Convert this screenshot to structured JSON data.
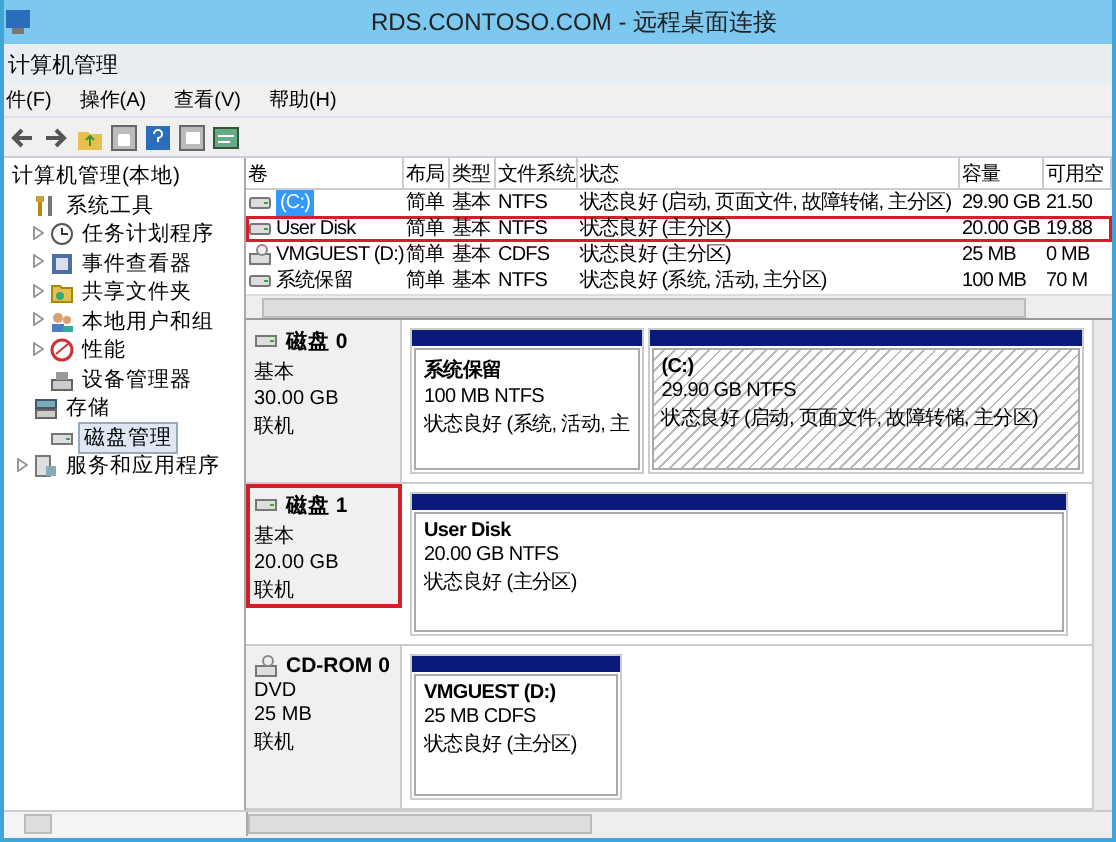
{
  "rds_title": "RDS.CONTOSO.COM - 远程桌面连接",
  "window": {
    "title": "计算机管理"
  },
  "menu": [
    "件(F)",
    "操作(A)",
    "查看(V)",
    "帮助(H)"
  ],
  "tree": [
    {
      "label": "计算机管理(本地)",
      "selected": false,
      "children": [
        {
          "label": "系统工具",
          "selected": false,
          "children": [
            {
              "label": "任务计划程序",
              "selected": false,
              "expanded": false
            },
            {
              "label": "事件查看器",
              "selected": false,
              "expanded": false
            },
            {
              "label": "共享文件夹",
              "selected": false,
              "expanded": false
            },
            {
              "label": "本地用户和组",
              "selected": false,
              "expanded": false
            },
            {
              "label": "性能",
              "selected": false,
              "expanded": false
            },
            {
              "label": "设备管理器",
              "selected": false
            }
          ]
        },
        {
          "label": "存储",
          "selected": false,
          "children": [
            {
              "label": "磁盘管理",
              "selected": true
            }
          ]
        },
        {
          "label": "服务和应用程序",
          "selected": false,
          "expanded": false
        }
      ]
    }
  ],
  "volumes": {
    "columns": [
      "卷",
      "布局",
      "类型",
      "文件系统",
      "状态",
      "容量",
      "可用空"
    ],
    "rows": [
      {
        "kind": "hdd",
        "cells": [
          "(C:)",
          "简单",
          "基本",
          "NTFS",
          "状态良好 (启动, 页面文件, 故障转储, 主分区)",
          "29.90 GB",
          "21.50"
        ],
        "selected": true,
        "highlighted": false
      },
      {
        "kind": "hdd",
        "cells": [
          "User Disk",
          "简单",
          "基本",
          "NTFS",
          "状态良好 (主分区)",
          "20.00 GB",
          "19.88"
        ],
        "selected": false,
        "highlighted": true
      },
      {
        "kind": "cdrom",
        "cells": [
          "VMGUEST (D:)",
          "简单",
          "基本",
          "CDFS",
          "状态良好 (主分区)",
          "25 MB",
          "0 MB"
        ],
        "selected": false,
        "highlighted": false
      },
      {
        "kind": "hdd",
        "cells": [
          "系统保留",
          "简单",
          "基本",
          "NTFS",
          "状态良好 (系统, 活动, 主分区)",
          "100 MB",
          "70 M"
        ],
        "selected": false,
        "highlighted": false
      }
    ]
  },
  "disks": [
    {
      "kind": "disk",
      "name": "磁盘 0",
      "type": "基本",
      "size": "30.00 GB",
      "status": "联机",
      "highlighted": false,
      "partitions": [
        {
          "name": "系统保留",
          "detail": "100 MB NTFS",
          "status": "状态良好 (系统, 活动, 主",
          "selected": false
        },
        {
          "name": "(C:)",
          "detail": "29.90 GB NTFS",
          "status": "状态良好 (启动, 页面文件, 故障转储, 主分区)",
          "selected": true
        }
      ]
    },
    {
      "kind": "disk",
      "name": "磁盘 1",
      "type": "基本",
      "size": "20.00 GB",
      "status": "联机",
      "highlighted": true,
      "partitions": [
        {
          "name": "User Disk",
          "detail": "20.00 GB NTFS",
          "status": "状态良好 (主分区)",
          "selected": false
        }
      ]
    },
    {
      "kind": "cdrom",
      "name": "CD-ROM 0",
      "type": "DVD",
      "size": "25 MB",
      "status": "联机",
      "highlighted": false,
      "partitions": [
        {
          "name": "VMGUEST  (D:)",
          "detail": "25 MB CDFS",
          "status": "状态良好 (主分区)",
          "selected": false
        }
      ]
    }
  ]
}
